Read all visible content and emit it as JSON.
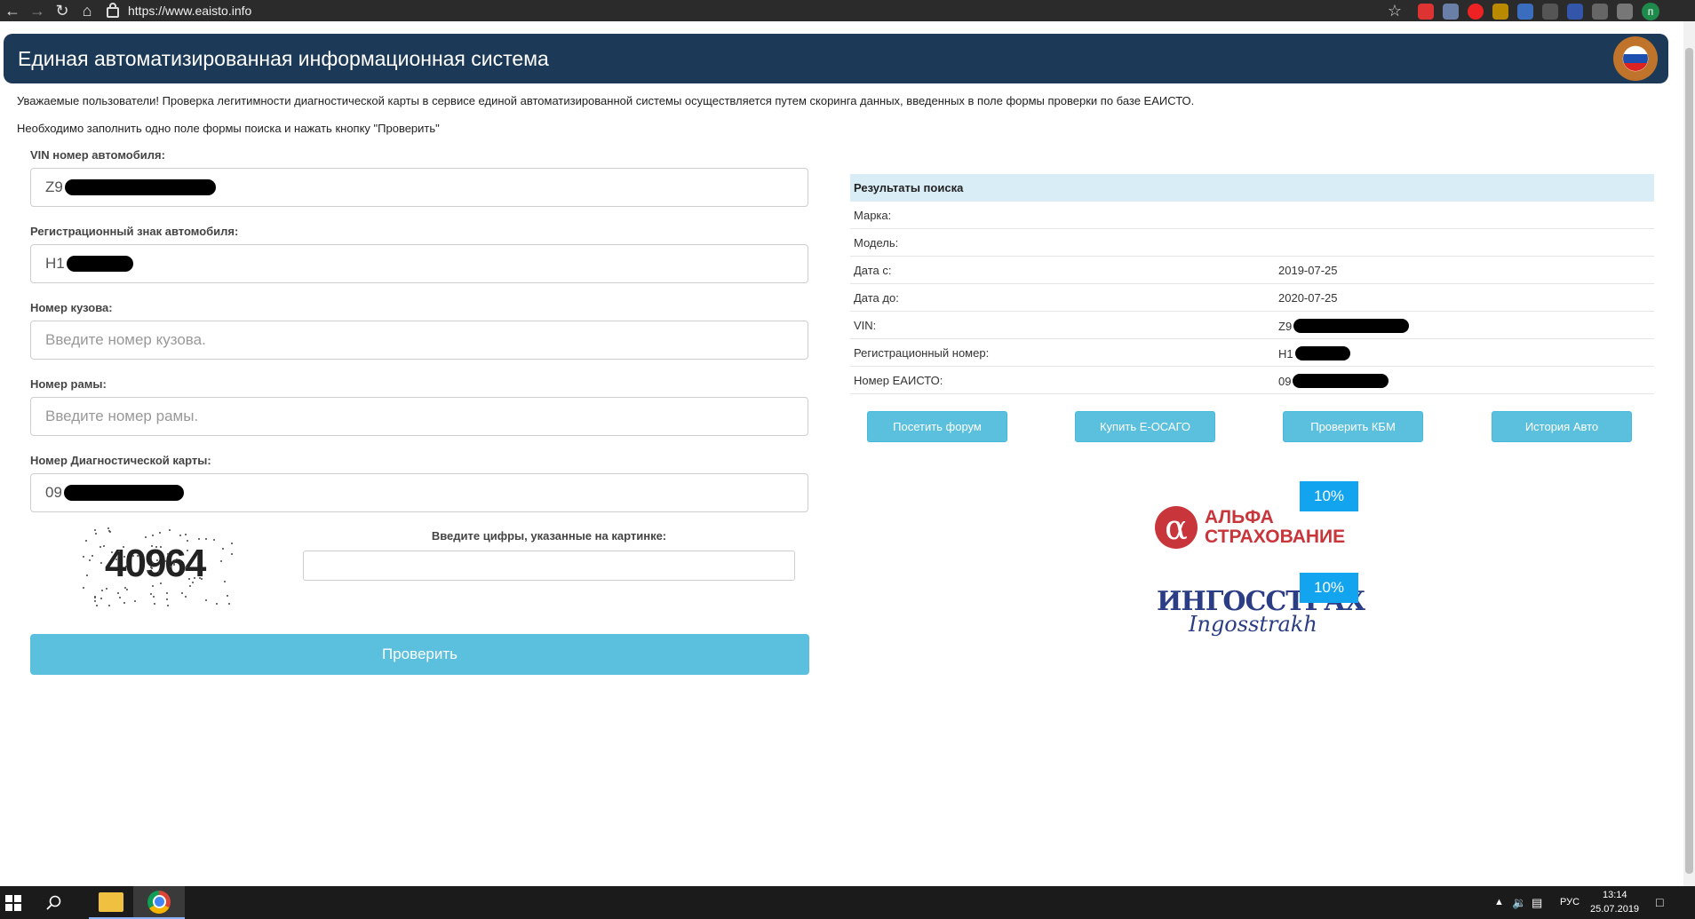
{
  "browser": {
    "url": "https://www.eaisto.info",
    "profile_initial": "п"
  },
  "header": {
    "title": "Единая автоматизированная информационная система"
  },
  "notice": {
    "line1": "Уважаемые пользователи! Проверка легитимности диагностической карты в сервисе единой автоматизированной системы осуществляется путем скоринга данных, введенных в поле формы проверки по базе ЕАИСТО.",
    "line2": "Необходимо заполнить одно поле формы поиска и нажать кнопку \"Проверить\""
  },
  "form": {
    "vin": {
      "label": "VIN номер автомобиля:",
      "value": "Z9"
    },
    "reg": {
      "label": "Регистрационный знак автомобиля:",
      "value": "Н1"
    },
    "body": {
      "label": "Номер кузова:",
      "placeholder": "Введите номер кузова."
    },
    "frame": {
      "label": "Номер рамы:",
      "placeholder": "Введите номер рамы."
    },
    "card": {
      "label": "Номер Диагностической карты:",
      "value": "09"
    },
    "captcha_code": "40964",
    "captcha_label": "Введите цифры, указанные на картинке:",
    "submit_label": "Проверить"
  },
  "results": {
    "heading": "Результаты поиска",
    "rows": [
      {
        "key": "Марка:",
        "value": ""
      },
      {
        "key": "Модель:",
        "value": ""
      },
      {
        "key": "Дата с:",
        "value": "2019-07-25"
      },
      {
        "key": "Дата до:",
        "value": "2020-07-25"
      },
      {
        "key": "VIN:",
        "value": "Z9"
      },
      {
        "key": "Регистрационный номер:",
        "value": "Н1"
      },
      {
        "key": "Номер ЕАИСТО:",
        "value": "09"
      }
    ]
  },
  "actions": {
    "forum": "Посетить форум",
    "osago": "Купить Е-ОСАГО",
    "kbm": "Проверить КБМ",
    "history": "История Авто"
  },
  "promos": {
    "alfa": {
      "badge": "10%",
      "line1": "АЛЬФА",
      "line2": "СТРАХОВАНИЕ",
      "symbol": "α"
    },
    "ingo": {
      "badge": "10%",
      "main": "ИНГОССТРАХ",
      "sub": "Ingosstrakh"
    }
  },
  "taskbar": {
    "lang": "РУС",
    "time": "13:14",
    "date": "25.07.2019"
  },
  "colors": {
    "header_bg": "#1c3a57",
    "button": "#5bc0de",
    "results_head": "#d9edf7",
    "badge": "#13a4f0",
    "alfa_red": "#c8353b",
    "ingo_blue": "#2b3d84"
  }
}
